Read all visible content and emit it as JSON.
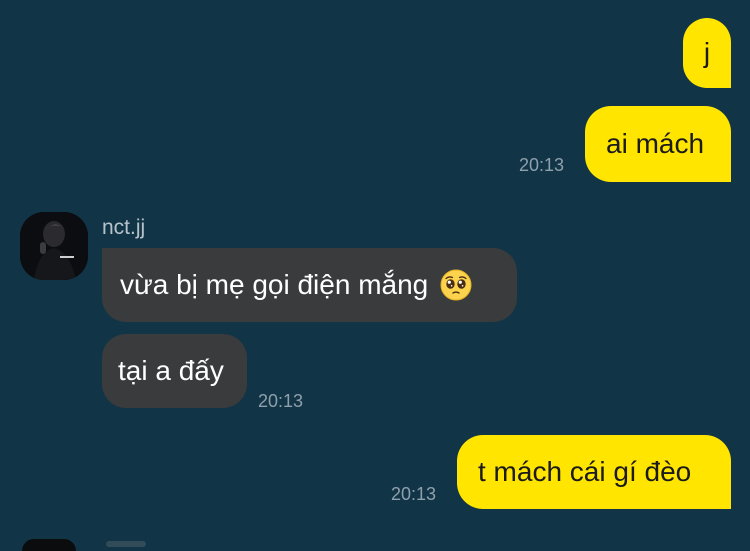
{
  "conversation": {
    "messages": [
      {
        "text": "j"
      },
      {
        "text": "ai mách",
        "time": "20:13"
      },
      {
        "sender": "nct.jj",
        "text": "vừa bị mẹ gọi điện mắng",
        "emoji": "pleading-face-icon"
      },
      {
        "text": "tại a đấy",
        "time": "20:13"
      },
      {
        "text": "t mách cái gí đèo",
        "time": "20:13"
      }
    ]
  },
  "colors": {
    "background": "#123447",
    "outgoing_bubble": "#ffe500",
    "incoming_bubble": "#3a3b3d",
    "timestamp": "#8ea0ab"
  }
}
